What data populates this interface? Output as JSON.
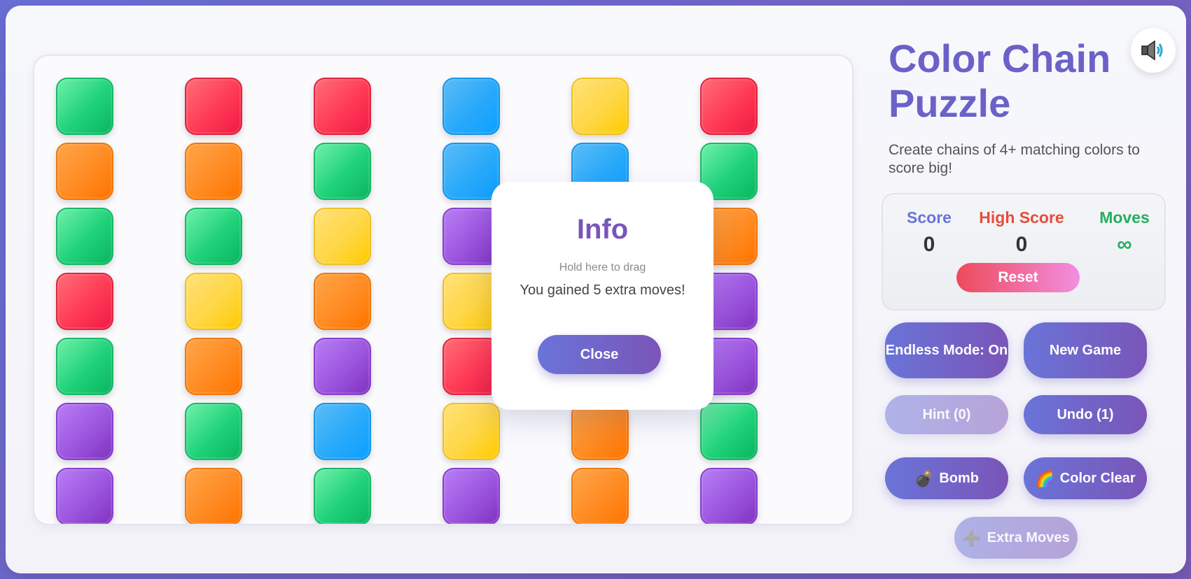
{
  "app": {
    "title": "Color Chain Puzzle",
    "subtitle": "Create chains of 4+ matching colors to score big!"
  },
  "sound": {
    "icon": "speaker-volume-icon"
  },
  "stats": {
    "score_label": "Score",
    "score_value": "0",
    "high_label": "High Score",
    "high_value": "0",
    "moves_label": "Moves",
    "moves_value": "∞",
    "reset_label": "Reset",
    "colors": {
      "score": "#6a74d8",
      "high": "#e74c3c",
      "moves": "#27ae60"
    }
  },
  "controls": {
    "endless_label": "Endless Mode: On",
    "new_game_label": "New Game",
    "hint_label": "Hint (0)",
    "undo_label": "Undo (1)",
    "bomb_label": "Bomb",
    "bomb_icon": "💣",
    "color_clear_label": "Color Clear",
    "color_clear_icon": "🌈",
    "extra_moves_label": "Extra Moves",
    "extra_moves_icon": "➕"
  },
  "modal": {
    "title": "Info",
    "drag_hint": "Hold here to drag",
    "message": "You gained 5 extra moves!",
    "close_label": "Close"
  },
  "board": {
    "columns": 6,
    "rows": [
      [
        "green",
        "red",
        "red",
        "blue",
        "yellow",
        "red"
      ],
      [
        "orange",
        "orange",
        "green",
        "blue",
        "blue",
        "green"
      ],
      [
        "green",
        "green",
        "yellow",
        "purple",
        "",
        "orange"
      ],
      [
        "red",
        "yellow",
        "orange",
        "yellow",
        "",
        "purple"
      ],
      [
        "green",
        "orange",
        "purple",
        "red",
        "",
        "purple"
      ],
      [
        "purple",
        "green",
        "blue",
        "yellow",
        "orange",
        "green"
      ],
      [
        "purple",
        "orange",
        "green",
        "purple",
        "orange",
        "purple"
      ]
    ]
  }
}
